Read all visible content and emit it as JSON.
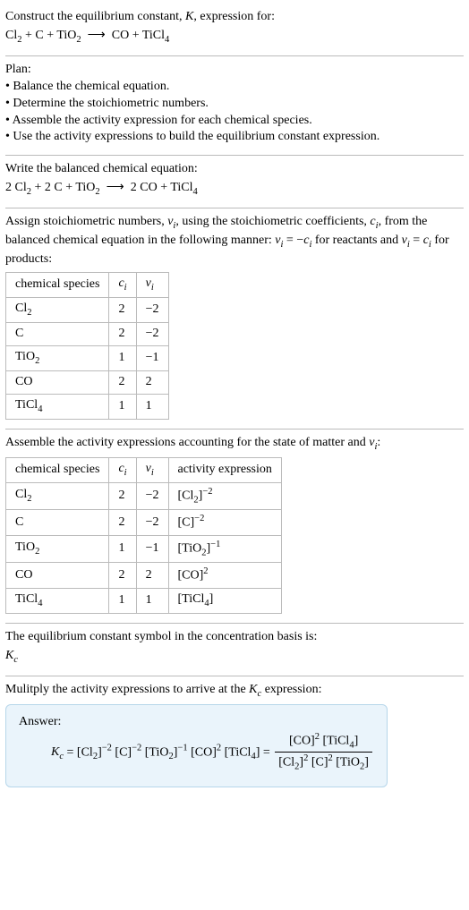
{
  "s1": {
    "l1": "Construct the equilibrium constant, K, expression for:",
    "l2": "Cl₂ + C + TiO₂ ⟶ CO + TiCl₄"
  },
  "s2": {
    "l1": "Plan:",
    "l2": "• Balance the chemical equation.",
    "l3": "• Determine the stoichiometric numbers.",
    "l4": "• Assemble the activity expression for each chemical species.",
    "l5": "• Use the activity expressions to build the equilibrium constant expression."
  },
  "s3": {
    "l1": "Write the balanced chemical equation:",
    "l2": "2 Cl₂ + 2 C + TiO₂ ⟶ 2 CO + TiCl₄"
  },
  "s4": {
    "intro1": "Assign stoichiometric numbers, νᵢ, using the stoichiometric coefficients, cᵢ, from",
    "intro2": "the balanced chemical equation in the following manner: νᵢ = −cᵢ for reactants",
    "intro3": "and νᵢ = cᵢ for products:",
    "h1": "chemical species",
    "h2": "cᵢ",
    "h3": "νᵢ",
    "r1c1": "Cl₂",
    "r1c2": "2",
    "r1c3": "−2",
    "r2c1": "C",
    "r2c2": "2",
    "r2c3": "−2",
    "r3c1": "TiO₂",
    "r3c2": "1",
    "r3c3": "−1",
    "r4c1": "CO",
    "r4c2": "2",
    "r4c3": "2",
    "r5c1": "TiCl₄",
    "r5c2": "1",
    "r5c3": "1"
  },
  "s5": {
    "intro": "Assemble the activity expressions accounting for the state of matter and νᵢ:",
    "h1": "chemical species",
    "h2": "cᵢ",
    "h3": "νᵢ",
    "h4": "activity expression",
    "r1c1": "Cl₂",
    "r1c2": "2",
    "r1c3": "−2",
    "r1c4": "[Cl₂]⁻²",
    "r2c1": "C",
    "r2c2": "2",
    "r2c3": "−2",
    "r2c4": "[C]⁻²",
    "r3c1": "TiO₂",
    "r3c2": "1",
    "r3c3": "−1",
    "r3c4": "[TiO₂]⁻¹",
    "r4c1": "CO",
    "r4c2": "2",
    "r4c3": "2",
    "r4c4": "[CO]²",
    "r5c1": "TiCl₄",
    "r5c2": "1",
    "r5c3": "1",
    "r5c4": "[TiCl₄]"
  },
  "s6": {
    "l1": "The equilibrium constant symbol in the concentration basis is:",
    "l2": "K_c"
  },
  "s7": {
    "l1": "Mulitply the activity expressions to arrive at the K_c expression:"
  },
  "ans": {
    "label": "Answer:",
    "lhs": "K_c = [Cl₂]⁻² [C]⁻² [TiO₂]⁻¹ [CO]² [TiCl₄] =",
    "num": "[CO]² [TiCl₄]",
    "den": "[Cl₂]² [C]² [TiO₂]"
  }
}
